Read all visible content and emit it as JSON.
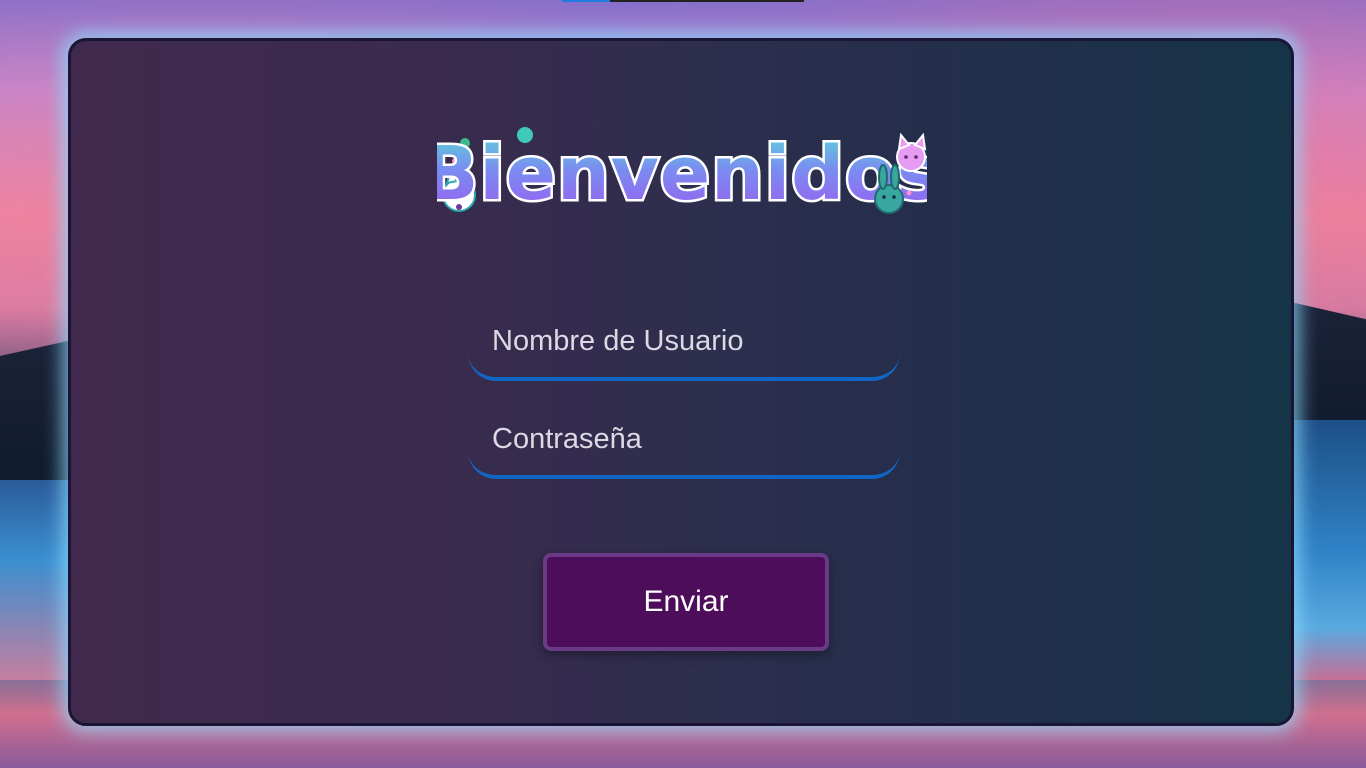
{
  "page": {
    "top_indicator_color": "#1e7be0"
  },
  "logo": {
    "text": "Bienvenidos",
    "colors": {
      "fill_top": "#5ad6d8",
      "fill_bottom": "#9b5cf0",
      "outline": "#ffffff"
    }
  },
  "form": {
    "username": {
      "placeholder": "Nombre de Usuario",
      "value": ""
    },
    "password": {
      "placeholder": "Contraseña",
      "value": ""
    },
    "submit_label": "Enviar"
  },
  "colors": {
    "panel_border": "#1a1535",
    "panel_glow": "#8cdcff",
    "input_underline": "#1166c4",
    "button_bg": "#4e0d5a",
    "button_border": "#6a3a88"
  }
}
